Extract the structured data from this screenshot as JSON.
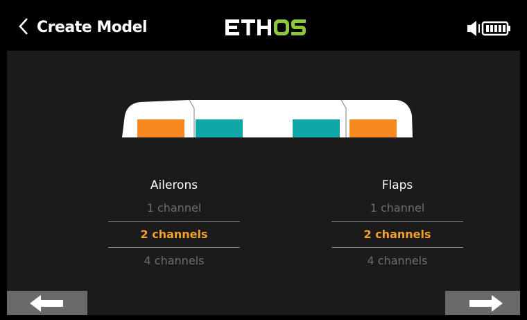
{
  "header": {
    "title": "Create Model",
    "logo_text": "ETHOS",
    "back_icon": "chevron-left-icon",
    "speaker_icon": "speaker-icon",
    "battery_icon": "battery-icon"
  },
  "colors": {
    "aileron_servo": "#f6891f",
    "flap_servo": "#11a6a8",
    "selected_text": "#f6a030",
    "unselected_text": "#6e6e6e",
    "logo_accent": "#8dc63f"
  },
  "ailerons": {
    "title": "Ailerons",
    "options": [
      "1 channel",
      "2 channels",
      "4 channels"
    ],
    "selected": "2 channels"
  },
  "flaps": {
    "title": "Flaps",
    "options": [
      "1 channel",
      "2 channels",
      "4 channels"
    ],
    "selected": "2 channels"
  },
  "navigation": {
    "prev_icon": "arrow-left-icon",
    "next_icon": "arrow-right-icon"
  }
}
